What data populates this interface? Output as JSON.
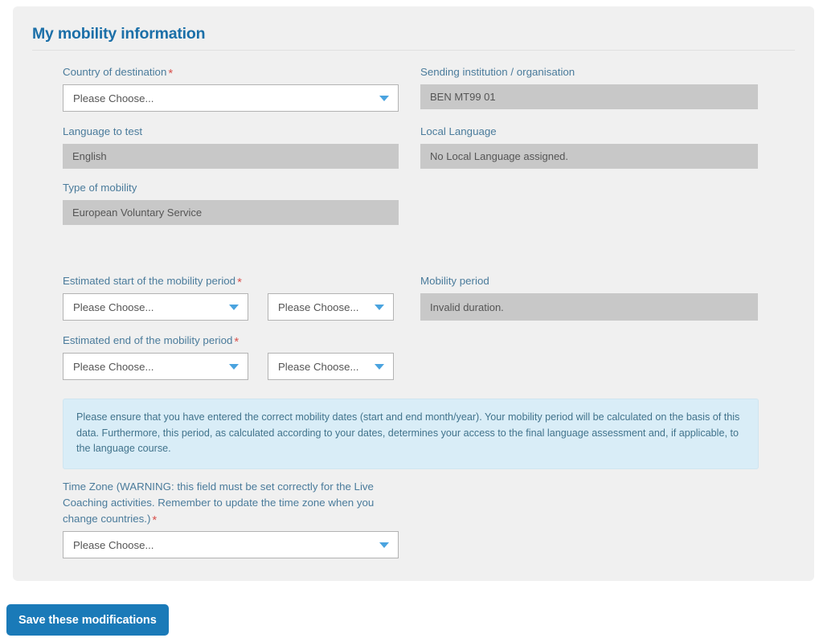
{
  "panel": {
    "title": "My mobility information"
  },
  "fields": {
    "country_of_destination": {
      "label": "Country of destination",
      "required": true,
      "value": "Please Choose...",
      "type": "select"
    },
    "sending_institution": {
      "label": "Sending institution / organisation",
      "required": false,
      "value": "BEN MT99 01",
      "type": "readonly"
    },
    "language_to_test": {
      "label": "Language to test",
      "required": false,
      "value": "English",
      "type": "readonly"
    },
    "local_language": {
      "label": "Local Language",
      "required": false,
      "value": "No Local Language assigned.",
      "type": "readonly"
    },
    "type_of_mobility": {
      "label": "Type of mobility",
      "required": false,
      "value": "European Voluntary Service",
      "type": "readonly"
    },
    "estimated_start": {
      "label": "Estimated start of the mobility period",
      "required": true,
      "month_value": "Please Choose...",
      "year_value": "Please Choose...",
      "type": "select-pair"
    },
    "estimated_end": {
      "label": "Estimated end of the mobility period",
      "required": true,
      "month_value": "Please Choose...",
      "year_value": "Please Choose...",
      "type": "select-pair"
    },
    "mobility_period": {
      "label": "Mobility period",
      "required": false,
      "value": "Invalid duration.",
      "type": "readonly"
    },
    "time_zone": {
      "label": "Time Zone (WARNING: this field must be set correctly for the Live Coaching activities. Remember to update the time zone when you change countries.)",
      "required": true,
      "value": "Please Choose...",
      "type": "select"
    }
  },
  "alert": {
    "text": "Please ensure that you have entered the correct mobility dates (start and end month/year). Your mobility period will be calculated on the basis of this data. Furthermore, this period, as calculated according to your dates, determines your access to the final language assessment and, if applicable, to the language course."
  },
  "actions": {
    "save_label": "Save these modifications"
  },
  "icons": {
    "caret_down": "chevron-down-icon",
    "required_marker": "*"
  },
  "colors": {
    "panel_bg": "#f0f0f0",
    "title_blue": "#1b6fa8",
    "label_blue": "#4a7b9b",
    "required_red": "#d9534f",
    "caret_blue": "#4aa3df",
    "readonly_bg": "#c8c8c8",
    "alert_bg": "#d9edf7",
    "button_blue": "#1a7ab8"
  }
}
